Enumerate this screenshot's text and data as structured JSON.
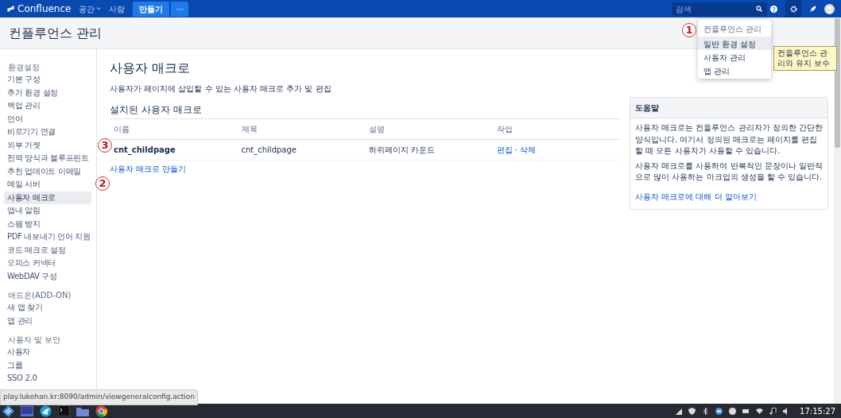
{
  "topbar": {
    "logo": "Confluence",
    "nav": [
      {
        "label": "공간",
        "dropdown": true
      },
      {
        "label": "사람",
        "dropdown": false
      }
    ],
    "create_button": "만들기",
    "more_button": "···",
    "search": {
      "placeholder": "검색"
    }
  },
  "page_title": "컨플루언스 관리",
  "sidebar": {
    "groups": [
      {
        "heading": "환경설정",
        "items": [
          {
            "label": "기본 구성",
            "selected": false
          },
          {
            "label": "추가 환경 설정",
            "selected": false
          },
          {
            "label": "백업 관리",
            "selected": false
          },
          {
            "label": "언어",
            "selected": false
          },
          {
            "label": "비로기기 연결",
            "selected": false
          },
          {
            "label": "외부 가젯",
            "selected": false
          },
          {
            "label": "전역 양식과 블루프린트",
            "selected": false
          },
          {
            "label": "추천 업데이트 이메일",
            "selected": false
          },
          {
            "label": "메일 서버",
            "selected": false
          },
          {
            "label": "사용자 매크로",
            "selected": true
          },
          {
            "label": "앱내 알림",
            "selected": false
          },
          {
            "label": "스팸 방지",
            "selected": false
          },
          {
            "label": "PDF 내보내기 언어 지원",
            "selected": false
          },
          {
            "label": "코드 매크로 설정",
            "selected": false
          },
          {
            "label": "오피스 커넥터",
            "selected": false
          },
          {
            "label": "WebDAV 구성",
            "selected": false
          }
        ]
      },
      {
        "heading": "애드온(ADD-ON)",
        "items": [
          {
            "label": "새 앱 찾기",
            "selected": false
          },
          {
            "label": "앱 관리",
            "selected": false
          }
        ]
      },
      {
        "heading": "사용자 및 보안",
        "items": [
          {
            "label": "사용자",
            "selected": false
          },
          {
            "label": "그룹",
            "selected": false
          },
          {
            "label": "SSO 2.0",
            "selected": false
          }
        ]
      }
    ]
  },
  "content": {
    "title": "사용자 매크로",
    "description": "사용자가 페이지에 삽입할 수 있는 사용자 매크로 추가 및 편집",
    "section_title": "설치된 사용자 매크로",
    "table": {
      "columns": [
        "이름",
        "제목",
        "설명",
        "작업"
      ],
      "rows": [
        {
          "name": "cnt_childpage",
          "title": "cnt_childpage",
          "description": "하위페이지 카운드",
          "actions": "편집 · 삭제"
        }
      ]
    },
    "create_link": "사용자 매크로 만들기"
  },
  "help": {
    "title": "도움말",
    "paragraphs": [
      "사용자 매크로는 컨플루언스 관리자가 정의한 간단한 양식입니다. 여기서 정의된 매크로는 페이지를 편집할 때 모든 사용자가 사용할 수 있습니다.",
      "사용자 매크로를 사용하여 반복적인 문장이나 일반적으로 많이 사용하는 마크업의 생성을 할 수 있습니다."
    ],
    "link": "사용자 매크로에 대해 더 알아보기"
  },
  "admin_menu": {
    "heading": "컨플루언스 관리",
    "items": [
      {
        "label": "일반 환경 설정",
        "selected": true
      },
      {
        "label": "사용자 관리",
        "selected": false
      },
      {
        "label": "앱 관리",
        "selected": false
      }
    ]
  },
  "tooltip": "컨플루언스 관리와 유지 보수",
  "annotations": [
    {
      "label": "1"
    },
    {
      "label": "2"
    },
    {
      "label": "3"
    }
  ],
  "status_url": "play.lukehan.kr:8090/admin/viewgeneralconfig.action",
  "taskbar": {
    "clock": "17:15:27"
  }
}
